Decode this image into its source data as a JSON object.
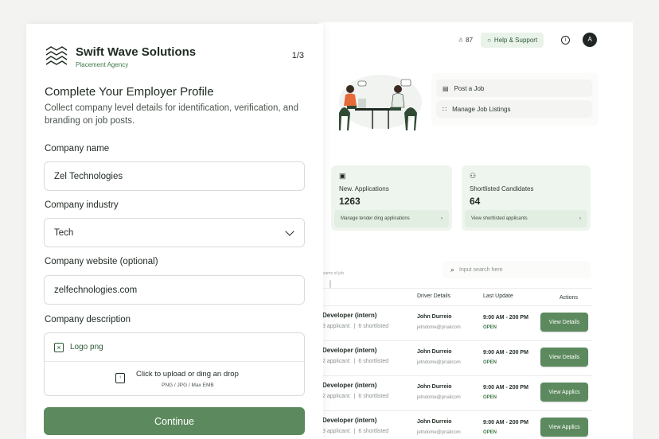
{
  "topbar": {
    "count": "87",
    "help_label": "Help & Support",
    "avatar_initial": "A"
  },
  "quick_links": [
    {
      "label": "Post a Job"
    },
    {
      "label": "Manage Job Listings"
    }
  ],
  "stats": [
    {
      "label": "New. Applications",
      "value": "1263",
      "link": "Manage tender ding applications"
    },
    {
      "label": "Shortlisted Candidates",
      "value": "64",
      "link": "View shortlisted applicants"
    }
  ],
  "search": {
    "placeholder": "Input search here"
  },
  "table": {
    "caption": "samo of job",
    "headers": [
      "Driver Details",
      "Last Update",
      "Actions"
    ],
    "rows": [
      {
        "title": "Developer (intern)",
        "applicants": "3 applicant:",
        "shortlisted": "6 shortlisted",
        "name": "John Durreio",
        "email": "jetndome@pnailcom",
        "time": "9:00 AM - 200 PM",
        "status": "OPEN",
        "action": "View Details"
      },
      {
        "title": "Developer (intern)",
        "applicants": "2 applicant:",
        "shortlisted": "6 shortlisted",
        "name": "John Durreio",
        "email": "jetndome@pnailcom",
        "time": "9:00 AM - 200 PM",
        "status": "OPEN",
        "action": "View Details"
      },
      {
        "title": "Developer (intern)",
        "applicants": "2 applicant:",
        "shortlisted": "6 shortlisted",
        "name": "John Durreio",
        "email": "jetndome@pnailcom",
        "time": "9:00 AM - 200 PM",
        "status": "OPEN",
        "action": "View Applics"
      },
      {
        "title": "Developer (intern)",
        "applicants": "3 applicant:",
        "shortlisted": "6 shortlisted",
        "name": "John Durreio",
        "email": "jetndome@pnailcom",
        "time": "9:00 AM - 200 PM",
        "status": "OPEN",
        "action": "View Applics"
      }
    ]
  },
  "form": {
    "brand": "Swift Wave Solutions",
    "brand_sub": "Placement Agency",
    "step": "1/3",
    "heading": "Complete Your Employer Profile",
    "description": "Collect company level details for identification, verification, and branding on job posts.",
    "company_name_label": "Company name",
    "company_name_value": "Zel Technologies",
    "industry_label": "Company industry",
    "industry_value": "Tech",
    "website_label": "Company website (optional)",
    "website_value": "zelfechnologies.com",
    "description_label": "Company description",
    "logo_label": "Logo png",
    "upload_text": "Click to upload or ding an drop",
    "upload_hint": "PNG / JPG / Max EMB",
    "continue_label": "Continue"
  },
  "colors": {
    "accent": "#5c8a5e",
    "accent_light": "#eef5ee",
    "text": "#1f2a22"
  }
}
